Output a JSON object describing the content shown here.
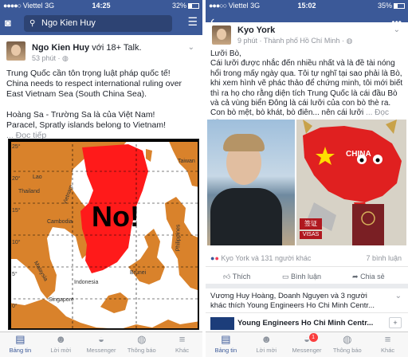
{
  "left": {
    "status": {
      "carrier": "Viettel",
      "network": "3G",
      "time": "14:25",
      "battery": "32%",
      "battery_level": 0.32
    },
    "search": {
      "text": "Ngo Kien Huy"
    },
    "post": {
      "author": "Ngo Kien Huy",
      "with_text": "với 18+ Talk.",
      "time": "53 phút",
      "lines": [
        "Trung Quốc cần tôn trọng luật pháp quốc tế!",
        "China needs to respect international ruling over East Vietnam Sea (South China Sea).",
        "",
        "Hoàng Sa - Trường Sa là của Việt Nam!",
        "Paracel, Spratly islands belong to Vietnam!"
      ],
      "more": "... Đọc tiếp"
    },
    "map": {
      "big_text": "No!",
      "labels": [
        "Lao",
        "Vietnam",
        "Thailand",
        "Cambodia",
        "Malaysia",
        "Singapore",
        "Indonesia",
        "Brunei",
        "Philippines",
        "Taiwan"
      ],
      "lat_ticks": [
        "25°",
        "20°",
        "15°",
        "10°",
        "5°",
        "0°"
      ]
    },
    "tabs": [
      {
        "label": "Bảng tin",
        "icon": "news-feed-icon",
        "active": true
      },
      {
        "label": "Lời mời",
        "icon": "friend-requests-icon"
      },
      {
        "label": "Messenger",
        "icon": "messenger-icon"
      },
      {
        "label": "Thông báo",
        "icon": "globe-icon"
      },
      {
        "label": "Khác",
        "icon": "more-icon"
      }
    ]
  },
  "right": {
    "status": {
      "carrier": "Viettel",
      "network": "3G",
      "time": "15:02",
      "battery": "35%",
      "battery_level": 0.35
    },
    "post": {
      "author": "Kyo York",
      "time": "9 phút",
      "location": "Thành phố Hồ Chí Minh",
      "lines": [
        "Lưỡi Bò,",
        "Cái lưỡi được nhắc đến nhiều nhất và là đề tài nóng hổi trong mấy ngày qua. Tôi tự nghĩ tại sao phải là Bò, khi xem hình vẽ phác thảo để chứng minh, tôi mới biết thì ra họ cho rằng diện tích Trung Quốc là cái đầu Bò và cả vùng biển Đông là cái lưỡi của con bò thè ra.",
        "Con bò mệt, bò khát, bò điên... nên cái lưỡi"
      ],
      "more": "... Đọc tiếp",
      "image_text": {
        "china": "CHINA",
        "stamp": "签证",
        "visas": "VISAS"
      },
      "reactions": "Kyo York và 131 người khác",
      "comments": "7 bình luận",
      "actions": [
        "Thích",
        "Bình luận",
        "Chia sẻ"
      ]
    },
    "next_post": {
      "line1": "Vương Huy Hoàng, Doanh Nguyen và 3 người",
      "line2": "khác thích Young Engineers Ho Chi Minh Centr...",
      "page": "Young Engineers Ho Chi Minh Centr..."
    },
    "tabs": [
      {
        "label": "Bảng tin",
        "icon": "news-feed-icon",
        "active": true
      },
      {
        "label": "Lời mời",
        "icon": "friend-requests-icon"
      },
      {
        "label": "Messenger",
        "icon": "messenger-icon",
        "badge": "1"
      },
      {
        "label": "Thông báo",
        "icon": "globe-icon"
      },
      {
        "label": "Khác",
        "icon": "more-icon"
      }
    ]
  },
  "colors": {
    "fb_blue": "#3b5998",
    "map_orange": "#d9822b",
    "map_red": "#ff1a1a"
  }
}
